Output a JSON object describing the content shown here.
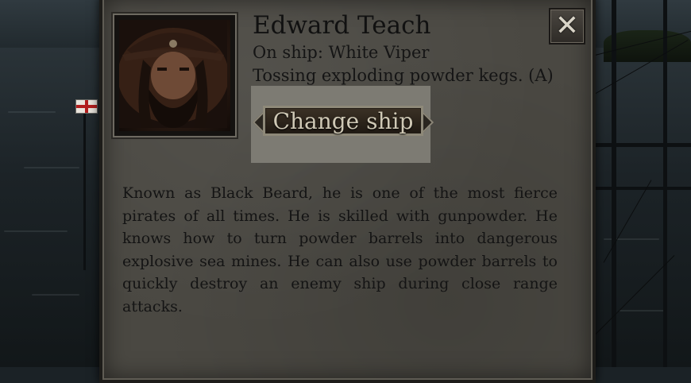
{
  "character": {
    "name": "Edward Teach",
    "ship_line": "On ship: White Viper",
    "ability_line": "Tossing exploding powder kegs. (A)",
    "description": "Known as Black Beard, he is one of the most fierce pirates of all times. He is skilled with gunpowder. He knows how to turn powder barrels into dangerous explosive sea mines. He can also use powder barrels to quickly destroy an enemy ship during close range attacks."
  },
  "buttons": {
    "change_ship": "Change ship",
    "close_glyph": "✕"
  },
  "icons": {
    "close": "close-icon",
    "portrait": "pirate-portrait"
  },
  "colors": {
    "panel": "#4a4842",
    "highlight": "#7d7b73",
    "button_text": "#cfc8b5",
    "body_text": "#141414"
  }
}
